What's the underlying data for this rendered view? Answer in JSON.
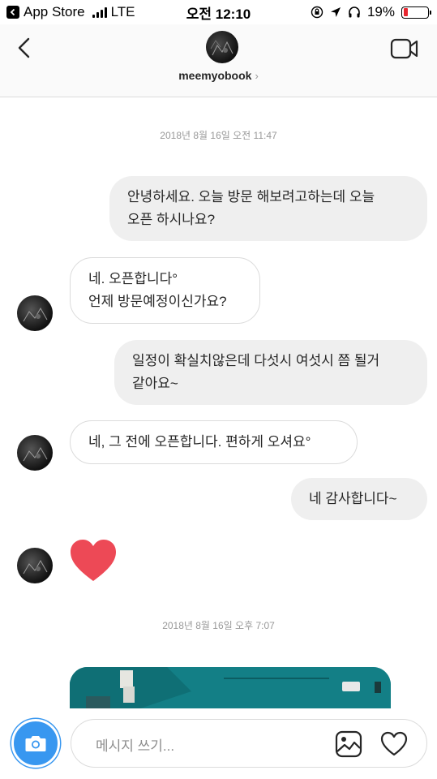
{
  "status_bar": {
    "back_app": "App Store",
    "carrier": "LTE",
    "time": "오전 12:10",
    "battery": "19%"
  },
  "header": {
    "username": "meemyobook",
    "chevron": "›"
  },
  "timestamps": {
    "first": "2018년 8월 16일 오전 11:47",
    "second": "2018년 8월 16일 오후 7:07"
  },
  "messages": [
    {
      "side": "sent",
      "line1": "안녕하세요. 오늘 방문 해보려고하는데 오늘",
      "line2": "오픈 하시나요?"
    },
    {
      "side": "received",
      "line1": "네. 오픈합니다°",
      "line2": "언제 방문예정이신가요?"
    },
    {
      "side": "sent",
      "line1": "일정이 확실치않은데 다섯시 여섯시 쯤 될거",
      "line2": "같아요~"
    },
    {
      "side": "received",
      "line1": "네, 그 전에 오픈합니다. 편하게 오셔요°"
    },
    {
      "side": "sent",
      "line1": "네 감사합니다~"
    },
    {
      "side": "received",
      "type": "heart"
    }
  ],
  "composer": {
    "placeholder": "메시지 쓰기..."
  },
  "colors": {
    "accent": "#3897f0",
    "heart": "#ed4956",
    "sent_bubble": "#efefef",
    "photo_wall": "#137f86"
  },
  "icons": [
    "app-store-back-icon",
    "signal-icon",
    "lock-rotation-icon",
    "location-icon",
    "headphones-icon",
    "battery-icon",
    "back-chevron-icon",
    "video-camera-icon",
    "camera-icon",
    "gallery-icon",
    "heart-outline-icon"
  ]
}
